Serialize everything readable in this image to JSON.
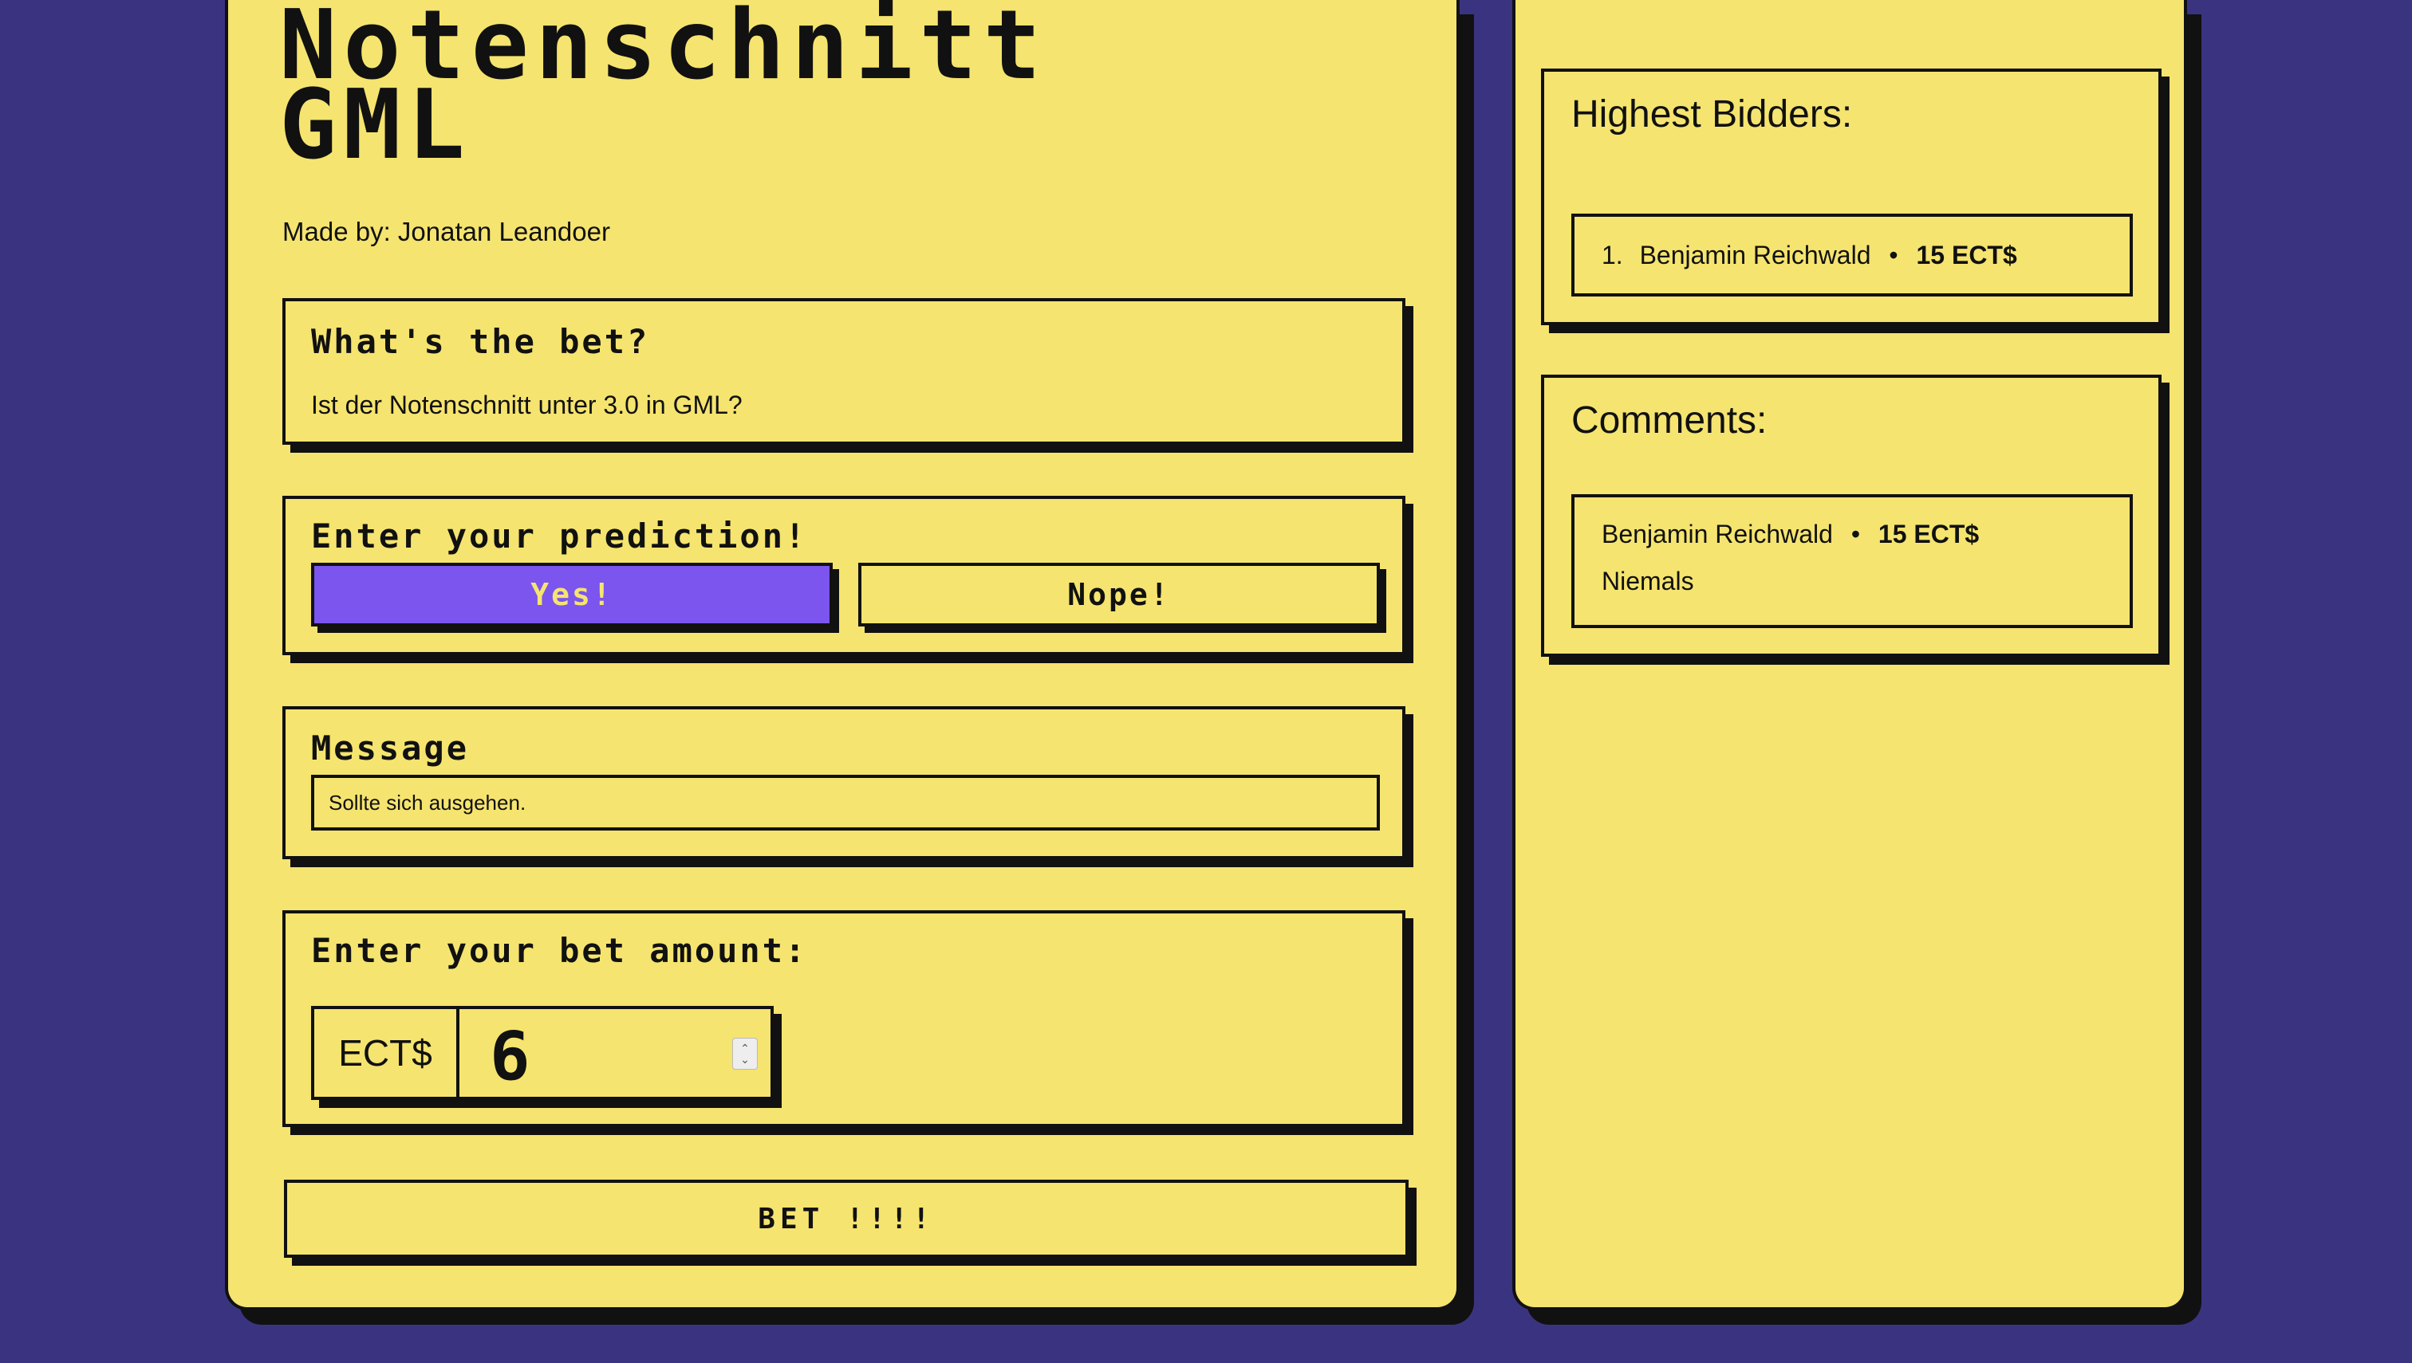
{
  "title_line1": "Notenschnitt",
  "title_line2": "GML",
  "made_by": "Made by: Jonatan Leandoer",
  "bet_question": {
    "heading": "What's the bet?",
    "text": "Ist der Notenschnitt unter 3.0 in GML?"
  },
  "prediction": {
    "heading": "Enter your prediction!",
    "yes_label": "Yes!",
    "no_label": "Nope!",
    "selected": "Yes!"
  },
  "message": {
    "heading": "Message",
    "value": "Sollte sich ausgehen."
  },
  "amount": {
    "heading": "Enter your bet amount:",
    "currency": "ECT$",
    "value": "6"
  },
  "submit_label": "BET !!!!",
  "highest_bidders": {
    "heading": "Highest Bidders:",
    "items": [
      {
        "rank": "1.",
        "name": "Benjamin Reichwald",
        "amount": "15 ECT$"
      }
    ]
  },
  "comments": {
    "heading": "Comments:",
    "items": [
      {
        "name": "Benjamin Reichwald",
        "amount": "15 ECT$",
        "text": "Niemals"
      }
    ]
  },
  "colors": {
    "background": "#3a3480",
    "panel": "#f5e46f",
    "accent": "#7b55ee",
    "border": "#111111"
  }
}
